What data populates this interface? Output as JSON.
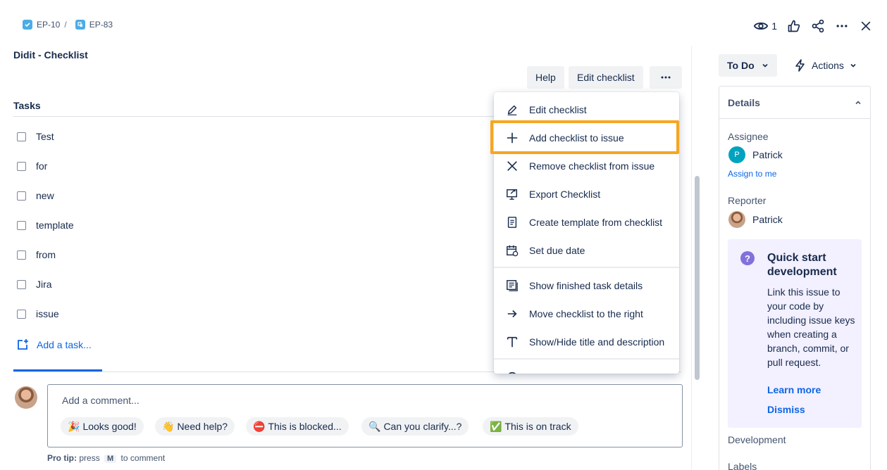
{
  "breadcrumb": [
    {
      "key": "EP-10",
      "icon": "checkbox-task-icon"
    },
    {
      "key": "EP-83",
      "icon": "subtask-icon"
    }
  ],
  "header": {
    "title": "Didit - Checklist",
    "watch_count": "1"
  },
  "toolbar": {
    "help_label": "Help",
    "edit_label": "Edit checklist",
    "more_label": "···"
  },
  "tasks": {
    "heading": "Tasks",
    "items": [
      "Test",
      "for",
      "new",
      "template",
      "from",
      "Jira",
      "issue"
    ],
    "add_label": "Add a task..."
  },
  "menu": {
    "items": [
      {
        "label": "Edit checklist",
        "icon": "pencil-icon"
      },
      {
        "label": "Add checklist to issue",
        "icon": "plus-icon",
        "highlighted": true
      },
      {
        "label": "Remove checklist from issue",
        "icon": "x-icon"
      },
      {
        "label": "Export Checklist",
        "icon": "export-icon"
      },
      {
        "label": "Create template from checklist",
        "icon": "document-icon"
      },
      {
        "label": "Set due date",
        "icon": "calendar-icon"
      },
      {
        "label": "Show finished task details",
        "icon": "details-icon"
      },
      {
        "label": "Move checklist to the right",
        "icon": "arrow-right-icon"
      },
      {
        "label": "Show/Hide title and description",
        "icon": "text-icon"
      }
    ],
    "highlight_color": "#f6a623"
  },
  "comment": {
    "placeholder": "Add a comment...",
    "chips": [
      {
        "emoji": "🎉",
        "label": "Looks good!"
      },
      {
        "emoji": "👋",
        "label": "Need help?"
      },
      {
        "emoji": "⛔",
        "label": "This is blocked..."
      },
      {
        "emoji": "🔍",
        "label": "Can you clarify...?"
      },
      {
        "emoji": "✅",
        "label": "This is on track"
      }
    ],
    "protip_label": "Pro tip:",
    "protip_press": "press",
    "protip_key": "M",
    "protip_suffix": "to comment"
  },
  "sidebar": {
    "status_label": "To Do",
    "actions_label": "Actions",
    "details_label": "Details",
    "assignee_label": "Assignee",
    "assignee_name": "Patrick",
    "assignee_initial": "P",
    "assign_to_me": "Assign to me",
    "reporter_label": "Reporter",
    "reporter_name": "Patrick",
    "quick_start": {
      "title": "Quick start development",
      "body": "Link this issue to your code by including issue keys when creating a branch, commit, or pull request.",
      "learn_more": "Learn more",
      "dismiss": "Dismiss"
    },
    "development_label": "Development",
    "labels_label": "Labels"
  },
  "colors": {
    "accent": "#0c66e4",
    "highlight": "#f6a623",
    "quick_start_bg": "#f3f0ff"
  }
}
